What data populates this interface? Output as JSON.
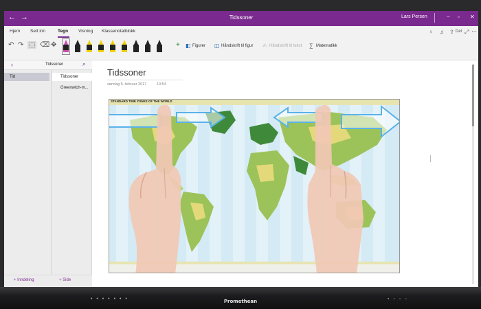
{
  "window": {
    "title": "Tidssoner",
    "user": "Lars Persen",
    "back_glyph": "←",
    "forward_glyph": "→",
    "minimize_glyph": "−",
    "maximize_glyph": "▫",
    "close_glyph": "✕"
  },
  "ribbon": {
    "tabs": [
      "Hjem",
      "Sett inn",
      "Tegn",
      "Visning",
      "Klassenotatblokk"
    ],
    "active_tab": "Tegn",
    "accent": "#7a2a8e",
    "pens": [
      {
        "tip": "#d04ab0",
        "band": "#d04ab0"
      },
      {
        "tip": "#222222",
        "band": "#222222"
      },
      {
        "tip": "#f0d000",
        "band": "#f0d000"
      },
      {
        "tip": "#f0d000",
        "band": "#f0d000"
      },
      {
        "tip": "#f0d000",
        "band": "#f0d000"
      },
      {
        "tip": "#f0d000",
        "band": "#f0d000"
      },
      {
        "tip": "#222222",
        "band": "#222222"
      },
      {
        "tip": "#222222",
        "band": "#222222"
      },
      {
        "tip": "#222222",
        "band": "#222222"
      }
    ],
    "shapes_label": "Figurer",
    "ink_to_shape_label": "Håndskrift til figur",
    "ink_to_text_label": "Håndskrift til tekst",
    "math_label": "Matematikk",
    "share_label": "Del"
  },
  "nav": {
    "header_label": "Tidssoner",
    "sections": [
      {
        "label": "Tid"
      }
    ],
    "pages": [
      {
        "label": "Tidssoner",
        "active": true
      },
      {
        "label": "Greenwich-m...",
        "active": false
      }
    ],
    "add_section_label": "+ Inndeling",
    "add_page_label": "+ Side"
  },
  "page": {
    "title": "Tidssoner",
    "date": "søndag 5. februar 2017",
    "time": "19:54",
    "map_title": "STANDARD TIME ZONES OF THE WORLD"
  },
  "device": {
    "brand": "Promethean"
  },
  "icons": [
    "back-arrow-icon",
    "forward-arrow-icon",
    "undo-icon",
    "redo-icon",
    "lasso-select-icon",
    "eraser-icon",
    "add-pen-icon",
    "shapes-icon",
    "ink-to-shape-icon",
    "ink-to-text-icon",
    "math-icon",
    "lightbulb-icon",
    "bell-icon",
    "share-icon",
    "expand-icon",
    "more-icon",
    "search-icon",
    "swipe-left-arrow-icon",
    "swipe-right-arrow-icon"
  ]
}
